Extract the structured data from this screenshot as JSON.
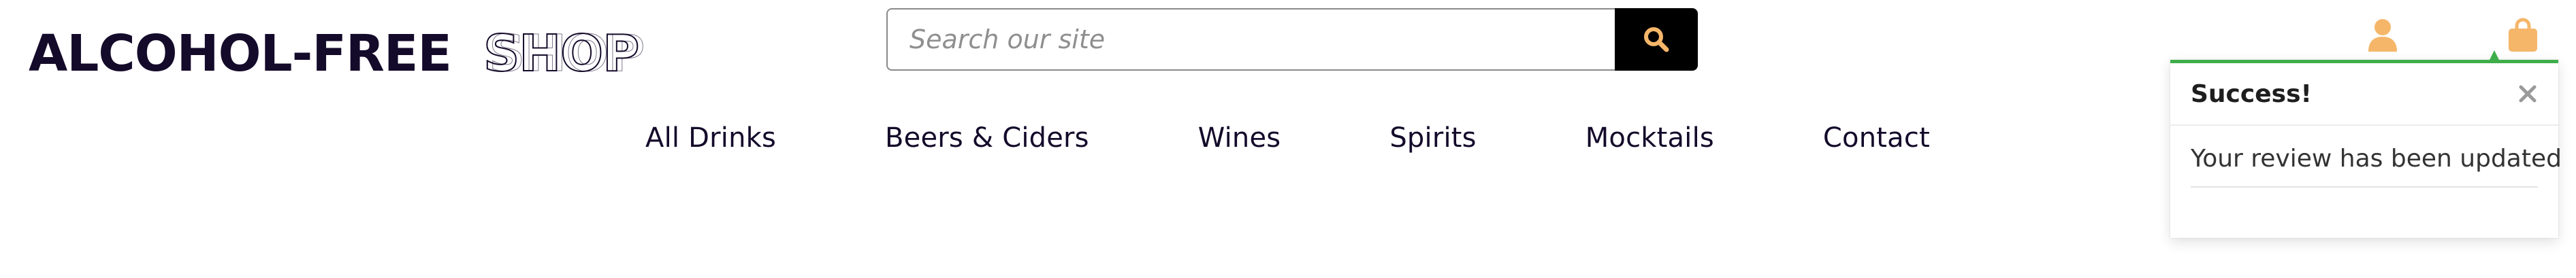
{
  "header": {
    "logo": {
      "primary_text": "ALCOHOL-FREE",
      "secondary_text": "SHOP"
    },
    "search": {
      "placeholder": "Search our site",
      "value": "",
      "button_icon": "search-icon"
    },
    "icons": {
      "account": "user-icon",
      "bag": "shopping-bag-icon"
    }
  },
  "nav": {
    "items": [
      {
        "label": "All Drinks"
      },
      {
        "label": "Beers & Ciders"
      },
      {
        "label": "Wines"
      },
      {
        "label": "Spirits"
      },
      {
        "label": "Mocktails"
      },
      {
        "label": "Contact"
      }
    ]
  },
  "toast": {
    "title": "Success!",
    "message": "Your review has been updated",
    "close_icon": "close-icon"
  },
  "colors": {
    "brand_dark": "#140a2a",
    "accent_orange": "#f5b66a",
    "success_green": "#3fae4a",
    "search_button_bg": "#000000"
  }
}
